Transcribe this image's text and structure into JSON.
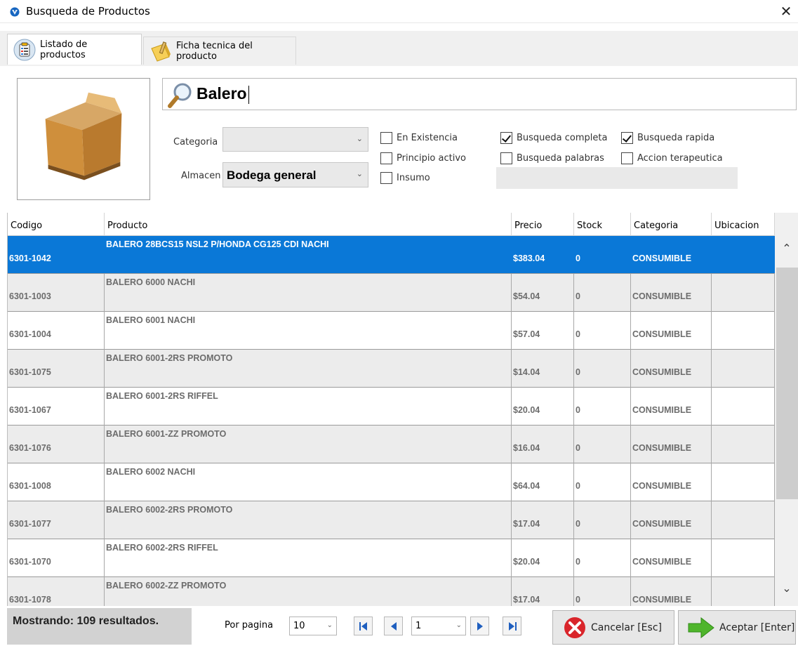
{
  "window": {
    "title": "Busqueda de Productos",
    "close_glyph": "✕"
  },
  "tabs": [
    {
      "label": "Listado de productos",
      "icon": "clipboard-list-icon",
      "active": true
    },
    {
      "label": "Ficha tecnica del producto",
      "icon": "pencil-note-icon",
      "active": false
    }
  ],
  "search": {
    "value": "Balero",
    "icon": "magnifier-icon"
  },
  "filters": {
    "categoria_label": "Categoria",
    "categoria_value": "",
    "almacen_label": "Almacen",
    "almacen_value": "Bodega general"
  },
  "options": [
    {
      "label": "En Existencia",
      "checked": false
    },
    {
      "label": "Busqueda completa",
      "checked": true
    },
    {
      "label": "Busqueda rapida",
      "checked": true
    },
    {
      "label": "Principio activo",
      "checked": false
    },
    {
      "label": "Busqueda palabras",
      "checked": false
    },
    {
      "label": "Accion terapeutica",
      "checked": false
    },
    {
      "label": "Insumo",
      "checked": false
    }
  ],
  "table": {
    "columns": [
      "Codigo",
      "Producto",
      "Precio",
      "Stock",
      "Categoria",
      "Ubicacion"
    ],
    "rows": [
      {
        "codigo": "6301-1042",
        "producto": "BALERO 28BCS15 NSL2  P/HONDA CG125 CDI NACHI",
        "precio": "$383.04",
        "stock": "0",
        "categoria": "CONSUMIBLE",
        "ubicacion": ""
      },
      {
        "codigo": "6301-1003",
        "producto": "BALERO 6000  NACHI",
        "precio": "$54.04",
        "stock": "0",
        "categoria": "CONSUMIBLE",
        "ubicacion": ""
      },
      {
        "codigo": "6301-1004",
        "producto": "BALERO 6001  NACHI",
        "precio": "$57.04",
        "stock": "0",
        "categoria": "CONSUMIBLE",
        "ubicacion": ""
      },
      {
        "codigo": "6301-1075",
        "producto": "BALERO 6001-2RS PROMOTO",
        "precio": "$14.04",
        "stock": "0",
        "categoria": "CONSUMIBLE",
        "ubicacion": ""
      },
      {
        "codigo": "6301-1067",
        "producto": "BALERO 6001-2RS RIFFEL",
        "precio": "$20.04",
        "stock": "0",
        "categoria": "CONSUMIBLE",
        "ubicacion": ""
      },
      {
        "codigo": "6301-1076",
        "producto": "BALERO 6001-ZZ PROMOTO",
        "precio": "$16.04",
        "stock": "0",
        "categoria": "CONSUMIBLE",
        "ubicacion": ""
      },
      {
        "codigo": "6301-1008",
        "producto": "BALERO 6002  NACHI",
        "precio": "$64.04",
        "stock": "0",
        "categoria": "CONSUMIBLE",
        "ubicacion": ""
      },
      {
        "codigo": "6301-1077",
        "producto": "BALERO 6002-2RS PROMOTO",
        "precio": "$17.04",
        "stock": "0",
        "categoria": "CONSUMIBLE",
        "ubicacion": ""
      },
      {
        "codigo": "6301-1070",
        "producto": "BALERO 6002-2RS RIFFEL",
        "precio": "$20.04",
        "stock": "0",
        "categoria": "CONSUMIBLE",
        "ubicacion": ""
      },
      {
        "codigo": "6301-1078",
        "producto": "BALERO 6002-ZZ PROMOTO",
        "precio": "$17.04",
        "stock": "0",
        "categoria": "CONSUMIBLE",
        "ubicacion": ""
      }
    ],
    "selected_index": 0
  },
  "footer": {
    "status_text": "Mostrando: 109 resultados.",
    "per_page_label": "Por pagina",
    "per_page_value": "10",
    "page_value": "1",
    "cancel_label": "Cancelar [Esc]",
    "accept_label": "Aceptar [Enter]"
  },
  "colors": {
    "selection": "#0a78d7",
    "row_alt": "#ececec",
    "row_text": "#6c6c6c",
    "cancel_icon": "#d9252b",
    "accept_icon": "#4fb52c"
  }
}
